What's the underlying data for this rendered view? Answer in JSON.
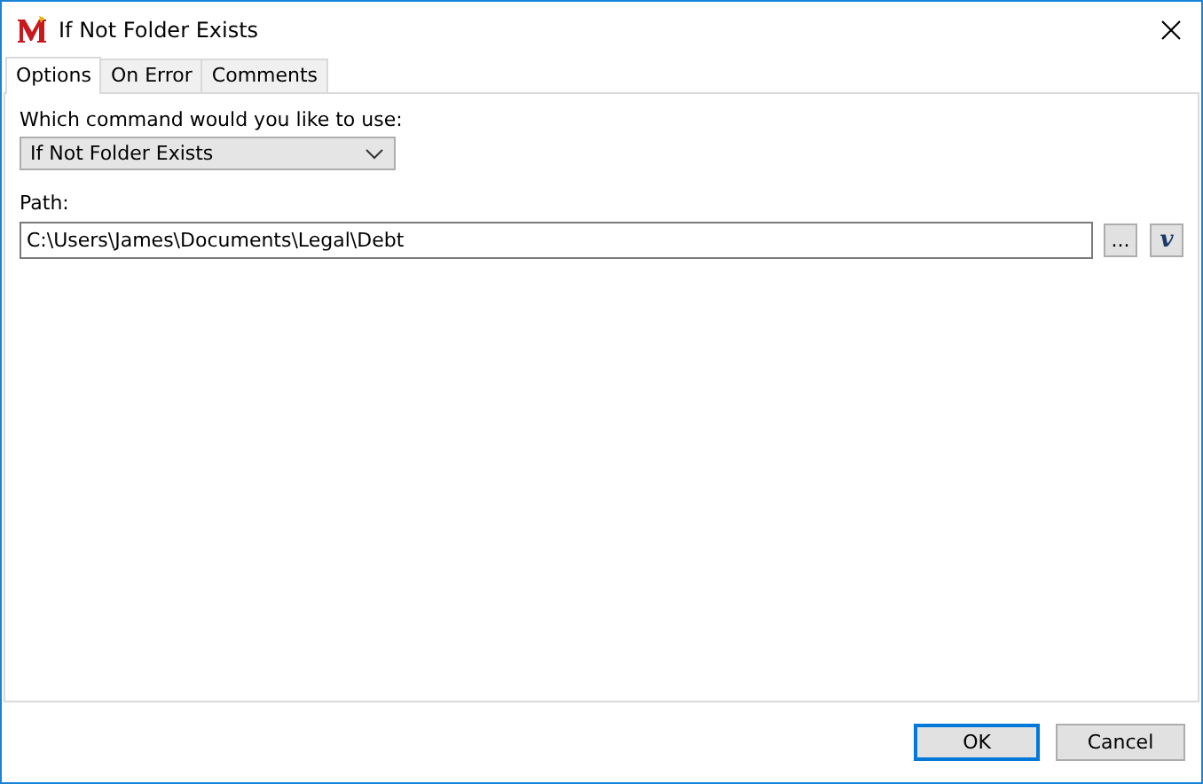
{
  "window": {
    "title": "If Not Folder Exists"
  },
  "tabs": [
    {
      "label": "Options",
      "selected": true
    },
    {
      "label": "On Error",
      "selected": false
    },
    {
      "label": "Comments",
      "selected": false
    }
  ],
  "command": {
    "label": "Which command would you like to use:",
    "value": "If Not Folder Exists"
  },
  "path": {
    "label": "Path:",
    "value": "C:\\Users\\James\\Documents\\Legal\\Debt",
    "browse": "...",
    "variable": "v"
  },
  "buttons": [
    {
      "label": "OK",
      "default": true
    },
    {
      "label": "Cancel",
      "default": false
    }
  ]
}
